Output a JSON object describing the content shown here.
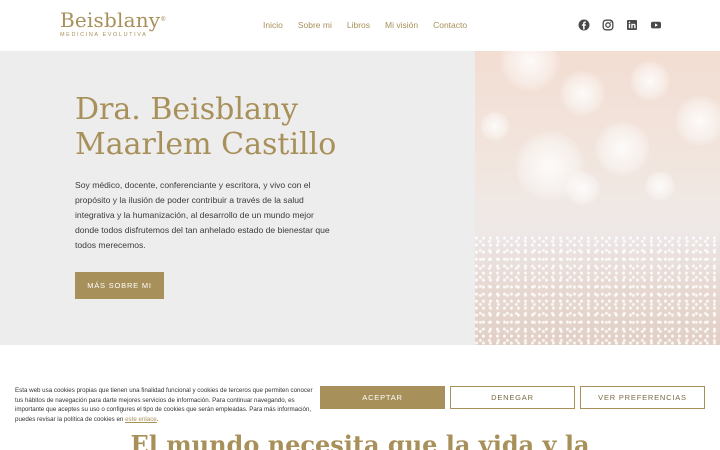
{
  "header": {
    "logo_title": "Beisblany",
    "logo_reg": "®",
    "logo_subtitle": "MEDICINA EVOLUTIVA",
    "nav": [
      "Inicio",
      "Sobre mi",
      "Libros",
      "Mi visión",
      "Contacto"
    ],
    "social_icons": [
      "facebook-icon",
      "instagram-icon",
      "linkedin-icon",
      "youtube-icon"
    ]
  },
  "hero": {
    "title_line1": "Dra. Beisblany",
    "title_line2": "Maarlem Castillo",
    "text": "Soy médico, docente, conferenciante y escritora, y vivo con el propósito y la ilusión de poder contribuir a través de la salud integrativa y la humanización, al desarrollo de un mundo mejor donde todos disfrutemos del tan anhelado estado de bienestar que todos merecemos.",
    "button_label": "MÁS SOBRE MI"
  },
  "section2": {
    "title": "El mundo necesita que la vida y la"
  },
  "cookie_banner": {
    "text": "Esta web usa cookies propias que tienen una finalidad funcional y cookies de terceros que permiten conocer tus hábitos de navegación para darte mejores servicios de información. Para continuar navegando, es importante que aceptes su uso o configures el tipo de cookies que serán empleadas. Para más información, puedes revisar la política de cookies en",
    "link_text": "este enlace",
    "after_link": ".",
    "accept_label": "ACEPTAR",
    "deny_label": "DENEGAR",
    "prefs_label": "VER PREFERENCIAS"
  },
  "colors": {
    "accent": "#a8905a",
    "hero_bg": "#eeeded"
  }
}
